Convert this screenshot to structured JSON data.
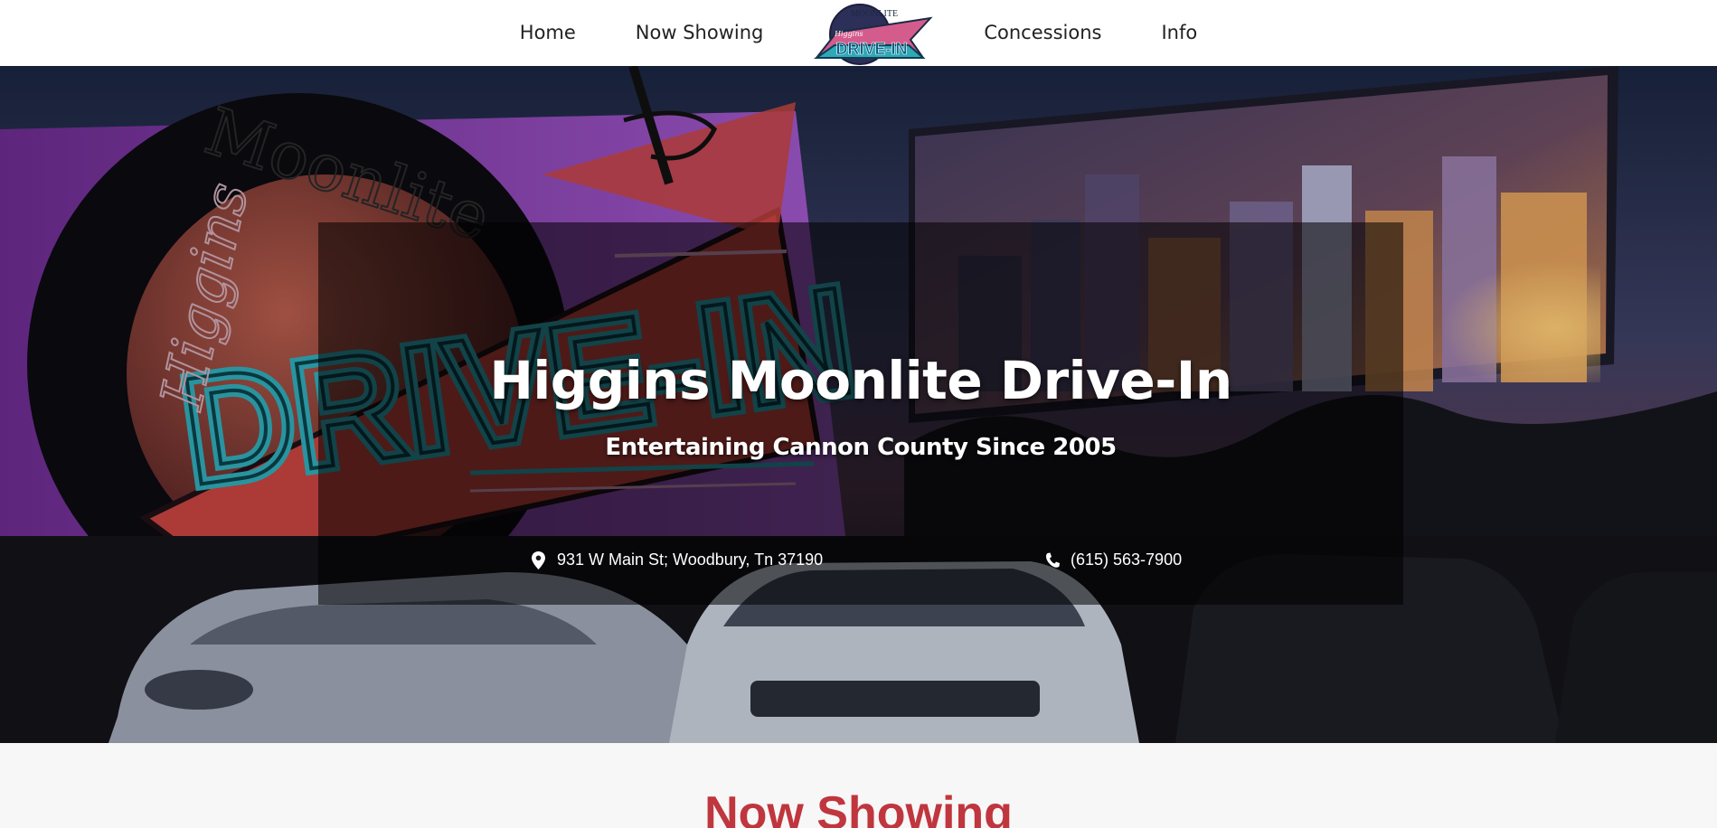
{
  "nav": {
    "items_left": [
      "Home",
      "Now Showing"
    ],
    "items_right": [
      "Concessions",
      "Info"
    ],
    "logo": {
      "arc_text": "MOONLITE",
      "script_text": "Higgins",
      "sign_text": "DRIVE-IN"
    }
  },
  "hero": {
    "title": "Higgins Moonlite Drive-In",
    "subtitle": "Entertaining Cannon County Since 2005",
    "address": "931 W Main St; Woodbury, Tn 37190",
    "phone": "(615) 563-7900",
    "sign": {
      "script": "Higgins",
      "arc": "Moonlite",
      "main": "DRIVE-IN"
    }
  },
  "section": {
    "title": "Now Showing"
  },
  "colors": {
    "accent_red": "#c0363e",
    "neon_teal": "#2fa9b6",
    "sign_purple": "#8b3fb8",
    "sign_red": "#c4433f"
  }
}
